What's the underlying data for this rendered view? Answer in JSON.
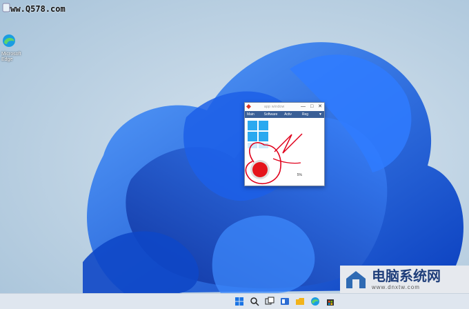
{
  "watermark": "www.Q578.com",
  "desktop": {
    "icons": [
      {
        "name": "recycle-bin",
        "label": ""
      },
      {
        "name": "microsoft-edge",
        "label": "Microsoft Edge"
      }
    ]
  },
  "window": {
    "title": "app window",
    "controls": [
      "—",
      "□",
      "✕"
    ],
    "menu": [
      "Main",
      "Software",
      "Activ",
      "Reg"
    ],
    "progress_text": "5%"
  },
  "caption": {
    "name": "电脑系统网",
    "url": "www.dnxtw.com"
  },
  "colors": {
    "accent": "#3a5f96",
    "annotation": "#e0001b",
    "wallpaper_blue": "#1e63e6"
  }
}
